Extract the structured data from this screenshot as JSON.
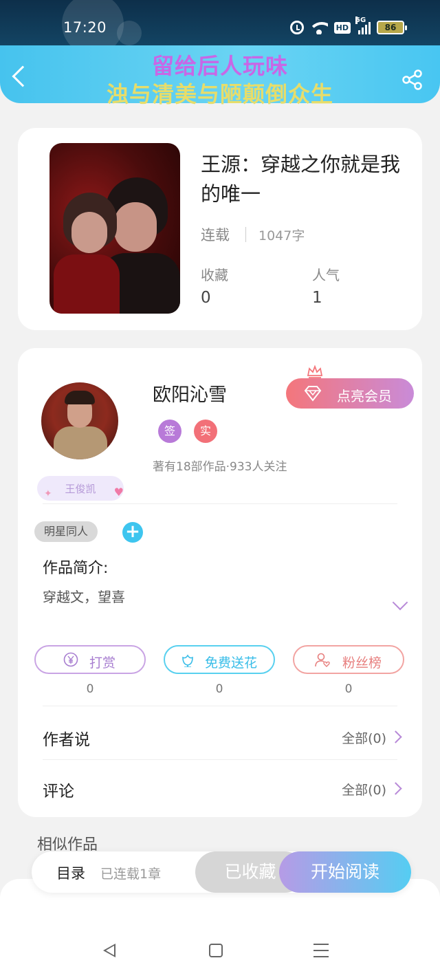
{
  "status_bar": {
    "time": "17:20",
    "network": "5G",
    "hd": "HD",
    "battery": "86"
  },
  "header": {
    "banner_line_1": "留给后人玩味",
    "banner_line_2": "浊与清美与陋颠倒众生",
    "banner_color_1": "#c867e6",
    "banner_color_2": "#e7dd6a"
  },
  "book": {
    "title": "王源：穿越之你就是我的唯一",
    "status": "连载",
    "word_count": "1047字",
    "stats": [
      {
        "label": "收藏",
        "value": "0"
      },
      {
        "label": "人气",
        "value": "1"
      }
    ]
  },
  "author": {
    "name": "欧阳沁雪",
    "member_button": "点亮会员",
    "badges": [
      "签",
      "实"
    ],
    "stats_text": "著有18部作品·933人关注",
    "fan_tag": "王俊凯"
  },
  "tags": {
    "genre": "明星同人",
    "add": "+"
  },
  "intro": {
    "label": "作品简介:",
    "text": "穿越文，望喜"
  },
  "actions": [
    {
      "label": "打赏",
      "count": "0",
      "icon": "yen-icon"
    },
    {
      "label": "免费送花",
      "count": "0",
      "icon": "flower-icon"
    },
    {
      "label": "粉丝榜",
      "count": "0",
      "icon": "fan-icon"
    }
  ],
  "rows": [
    {
      "label": "作者说",
      "all": "全部(0)"
    },
    {
      "label": "评论",
      "all": "全部(0)"
    }
  ],
  "similar_title": "相似作品",
  "bottom_bar": {
    "toc_label": "目录",
    "toc_count": "已连载1章",
    "collected": "已收藏",
    "read": "开始阅读"
  },
  "colors": {
    "accent_blue": "#46c3ee",
    "accent_purple": "#b88ad8",
    "accent_pink": "#f4767b"
  }
}
